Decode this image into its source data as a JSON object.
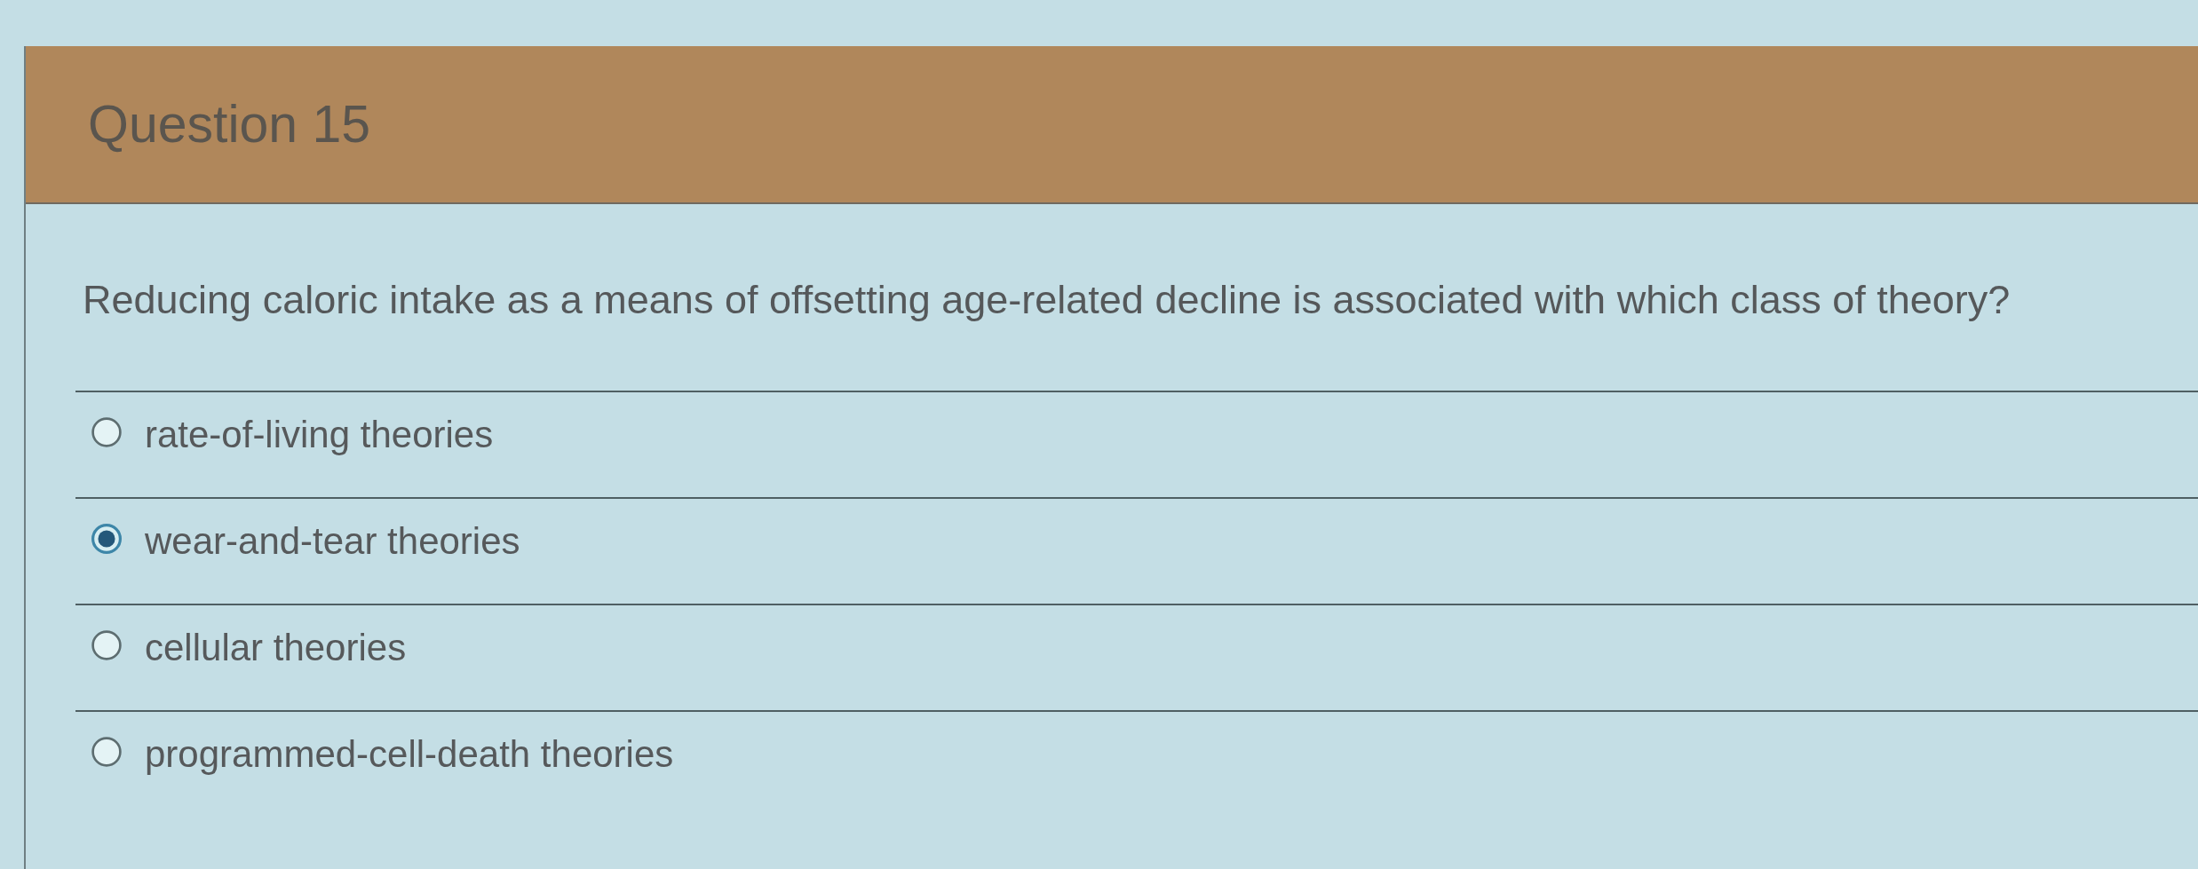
{
  "question": {
    "title": "Question 15",
    "text": "Reducing caloric intake as a means of offsetting age-related decline is associated with which class of theory?"
  },
  "answers": [
    {
      "label": "rate-of-living theories",
      "selected": false
    },
    {
      "label": "wear-and-tear theories",
      "selected": true
    },
    {
      "label": "cellular theories",
      "selected": false
    },
    {
      "label": "programmed-cell-death theories",
      "selected": false
    }
  ]
}
